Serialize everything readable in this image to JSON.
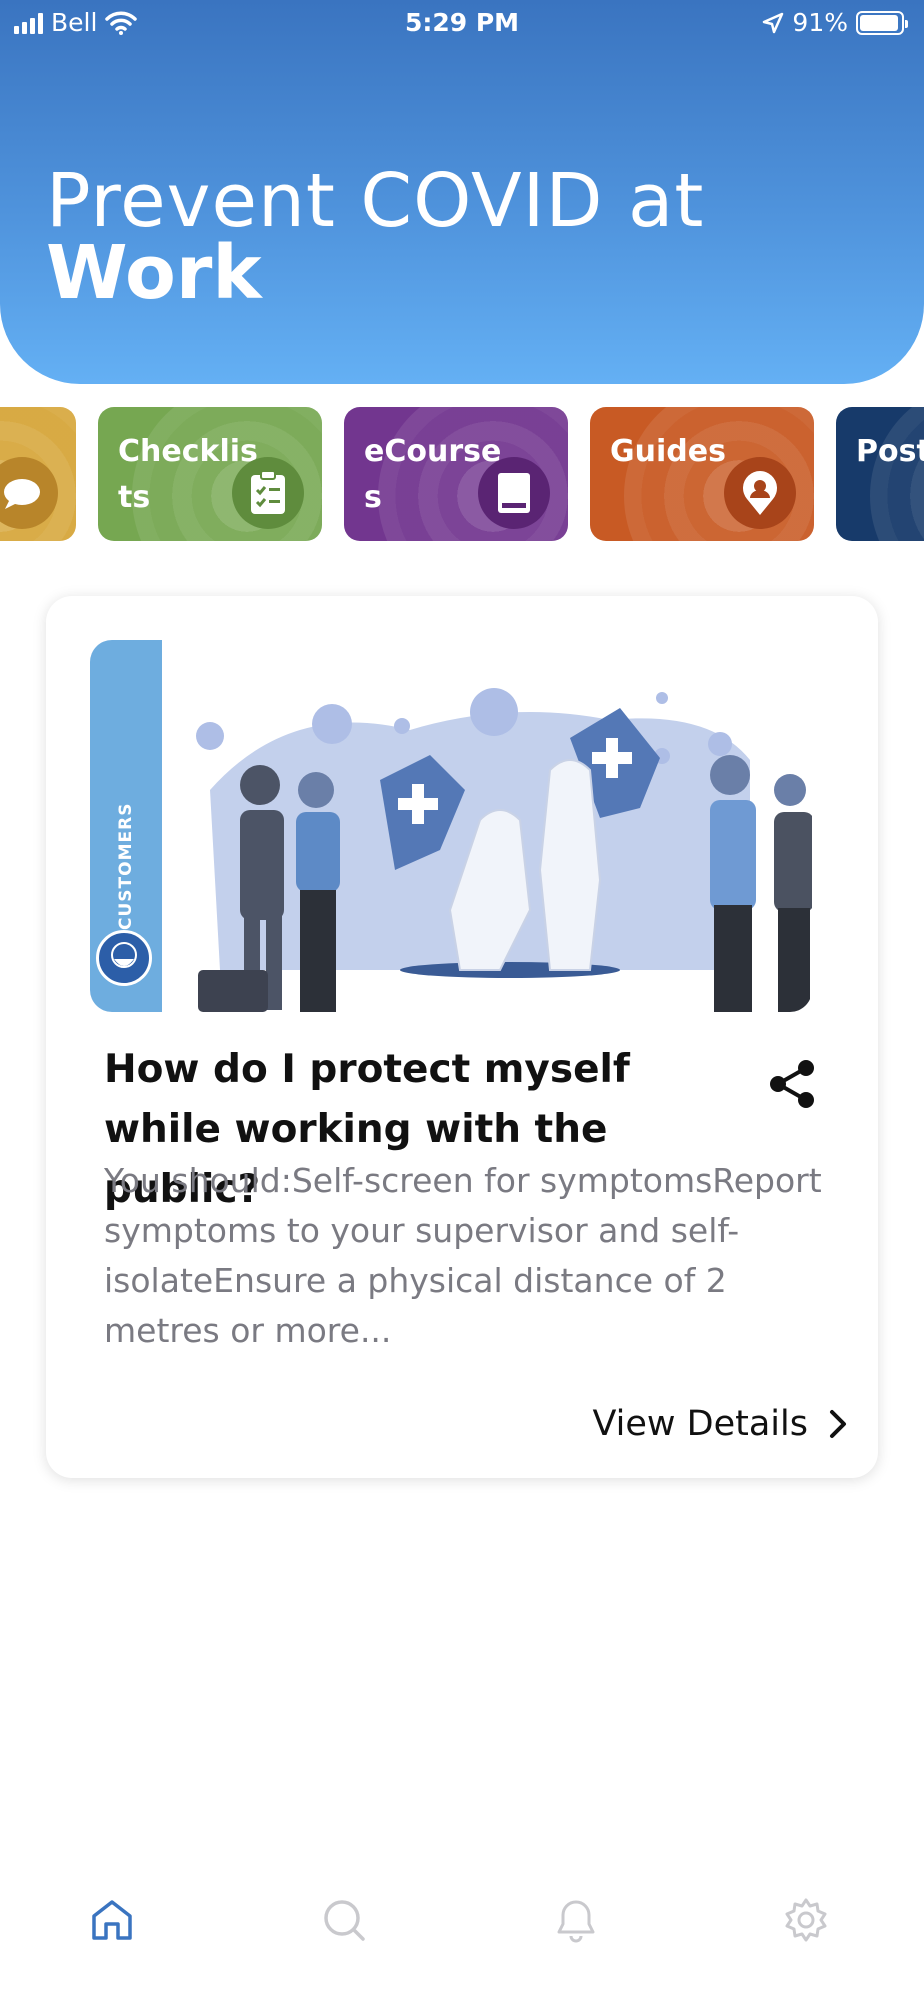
{
  "status_bar": {
    "carrier": "Bell",
    "time": "5:29 PM",
    "battery": "91%"
  },
  "header": {
    "title_line1": "Prevent COVID at",
    "title_line2": "Work"
  },
  "categories": [
    {
      "label": "",
      "color": "#d6a63a"
    },
    {
      "label": "Checklists",
      "color": "#76a751"
    },
    {
      "label": "eCourses",
      "color": "#72368f"
    },
    {
      "label": "Guides",
      "color": "#c85a24"
    },
    {
      "label": "Post",
      "color": "#173a6a"
    }
  ],
  "card": {
    "tag": "CUSTOMERS",
    "title": "How do I protect myself while working with the public?",
    "description": "You should:Self-screen for symptomsReport symptoms to your supervisor and self-isolateEnsure a physical distance of 2 metres or more...",
    "link": "View Details"
  },
  "nav": [
    "home-icon",
    "search-icon",
    "bell-icon",
    "gear-icon"
  ]
}
